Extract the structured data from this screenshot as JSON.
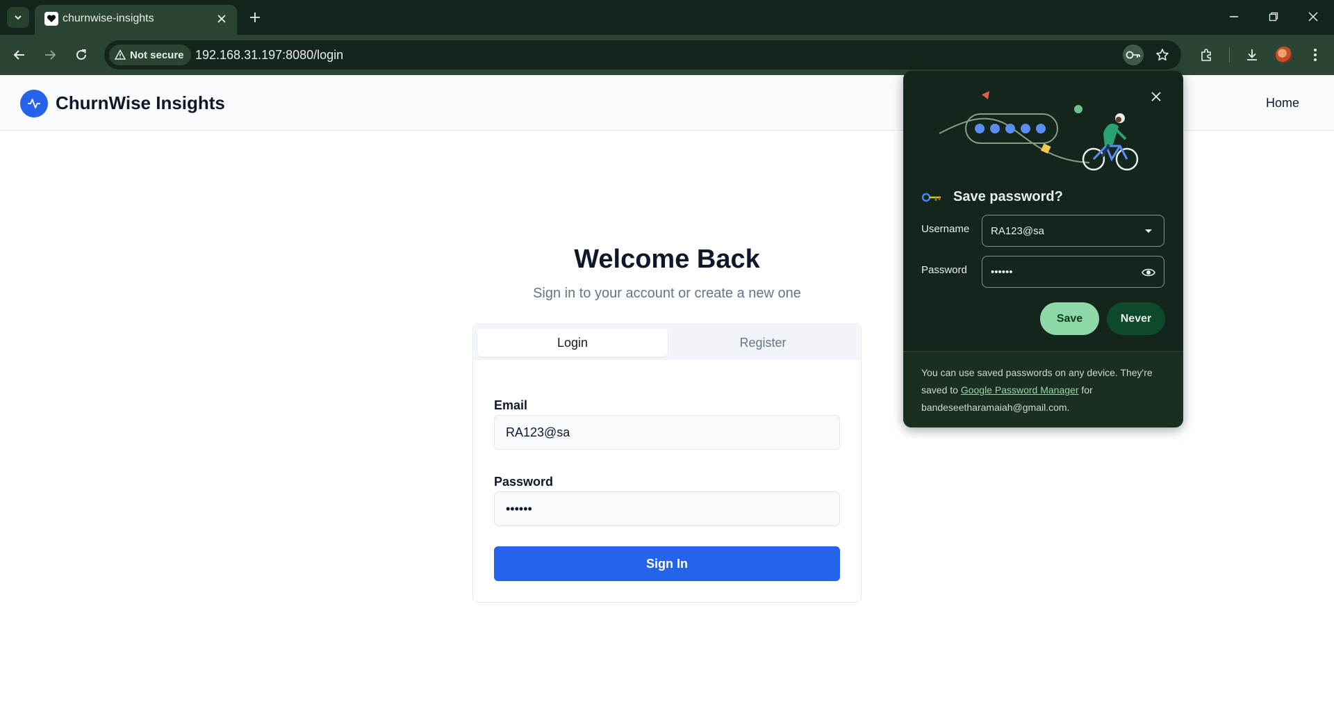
{
  "browser": {
    "tab_title": "churnwise-insights",
    "security_label": "Not secure",
    "url": "192.168.31.197:8080/login"
  },
  "header": {
    "brand": "ChurnWise Insights",
    "home_link": "Home"
  },
  "main": {
    "title": "Welcome Back",
    "subtitle": "Sign in to your account or create a new one",
    "tabs": [
      {
        "label": "Login",
        "active": true
      },
      {
        "label": "Register",
        "active": false
      }
    ],
    "email_label": "Email",
    "email_value": "RA123@sa",
    "password_label": "Password",
    "password_value": "••••••",
    "signin_label": "Sign In"
  },
  "password_bubble": {
    "title": "Save password?",
    "username_label": "Username",
    "username_value": "RA123@sa",
    "password_label": "Password",
    "password_value": "••••••",
    "save_label": "Save",
    "never_label": "Never",
    "footer_prefix": "You can use saved passwords on any device. They're saved to ",
    "footer_link": "Google Password Manager",
    "footer_suffix": " for bandeseetharamaiah@gmail.com."
  },
  "colors": {
    "accent": "#2563eb",
    "chrome_dark": "#14261b",
    "chrome_mid": "#2b4433",
    "save_green": "#8fd9a8",
    "never_green": "#0d4a2c"
  },
  "icons": [
    "tab-list-icon",
    "favicon-heart-icon",
    "close-icon",
    "plus-icon",
    "minimize-icon",
    "restore-icon",
    "back-icon",
    "forward-icon",
    "reload-icon",
    "warning-icon",
    "key-icon",
    "star-icon",
    "extensions-icon",
    "download-icon",
    "more-icon",
    "activity-icon",
    "chevron-down-icon",
    "eye-icon"
  ]
}
